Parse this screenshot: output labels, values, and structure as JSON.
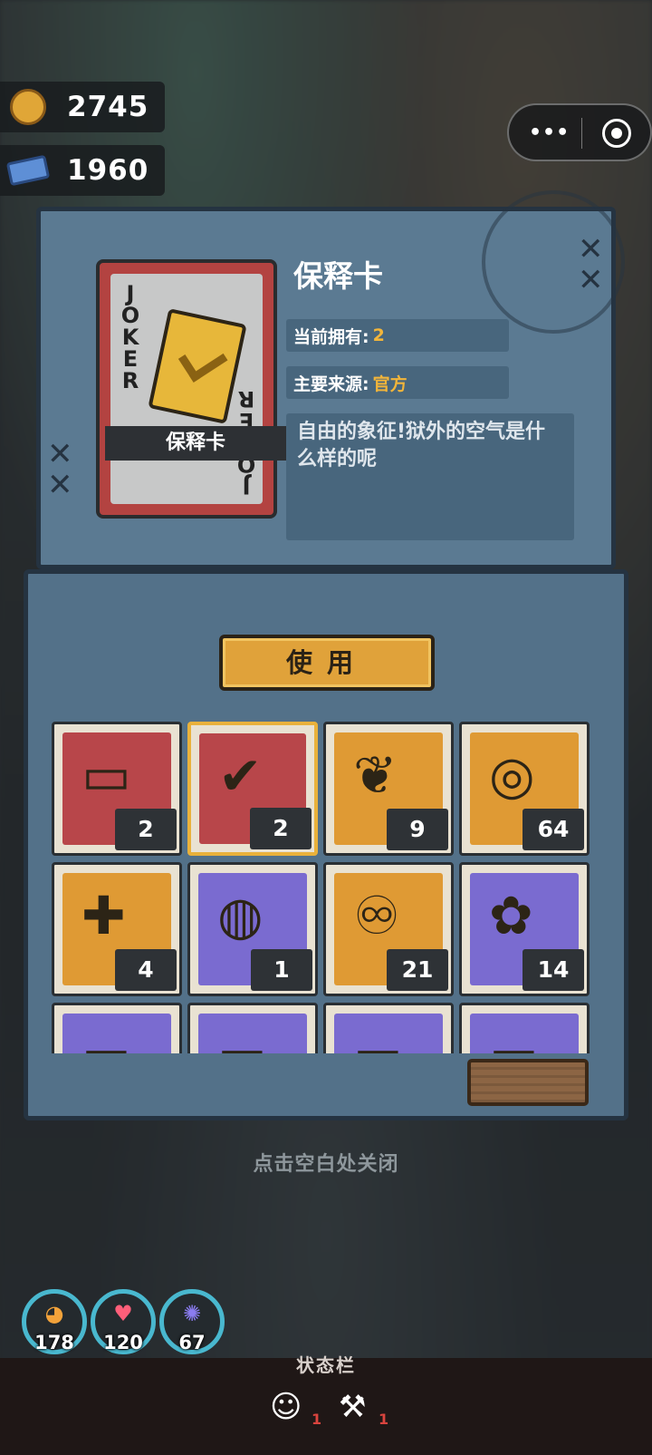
{
  "currencies": [
    {
      "icon": "gold-coin-icon",
      "value": "2745"
    },
    {
      "icon": "blue-ticket-icon",
      "value": "1960"
    }
  ],
  "capsule": {
    "more": "•••"
  },
  "card": {
    "corner_text": "JOKER",
    "banner": "保释卡",
    "name": "保释卡",
    "owned_label": "当前拥有:",
    "owned_value": "2",
    "source_label": "主要来源:",
    "source_value": "官方",
    "description": "自由的象征!狱外的空气是什么样的呢"
  },
  "x_marks": {
    "top": "✕\n✕",
    "left": "✕\n✕"
  },
  "use_button": "使用",
  "items": [
    {
      "count": "2",
      "bg": "red",
      "icon": "id-card-icon"
    },
    {
      "count": "2",
      "bg": "red",
      "icon": "bail-card-icon",
      "selected": true
    },
    {
      "count": "9",
      "bg": "orange",
      "icon": "paw-scroll-icon"
    },
    {
      "count": "64",
      "bg": "orange",
      "icon": "film-reel-icon"
    },
    {
      "count": "4",
      "bg": "orange",
      "icon": "medical-card-icon"
    },
    {
      "count": "1",
      "bg": "purple",
      "icon": "steak-meal-icon"
    },
    {
      "count": "21",
      "bg": "orange",
      "icon": "ribbon-card-icon"
    },
    {
      "count": "14",
      "bg": "purple",
      "icon": "bow-ticket-icon"
    },
    {
      "count": "",
      "bg": "purple",
      "icon": "item-icon"
    },
    {
      "count": "",
      "bg": "purple",
      "icon": "item-icon"
    },
    {
      "count": "",
      "bg": "purple",
      "icon": "item-icon"
    },
    {
      "count": "",
      "bg": "purple",
      "icon": "item-icon"
    }
  ],
  "close_hint": "点击空白处关闭",
  "stats": [
    {
      "icon": "food-icon",
      "value": "178"
    },
    {
      "icon": "heart-icon",
      "value": "120"
    },
    {
      "icon": "brain-icon",
      "value": "67"
    }
  ],
  "status_bar": {
    "title": "状态栏",
    "effects": [
      {
        "icon": "theater-masks-icon",
        "count": "1"
      },
      {
        "icon": "hammer-upgrade-icon",
        "count": "1"
      }
    ]
  },
  "colors": {
    "accent": "#e0a23a",
    "panel": "#5b7a92",
    "selected_border": "#e9b13b",
    "stat_ring": "#49b8cf"
  }
}
